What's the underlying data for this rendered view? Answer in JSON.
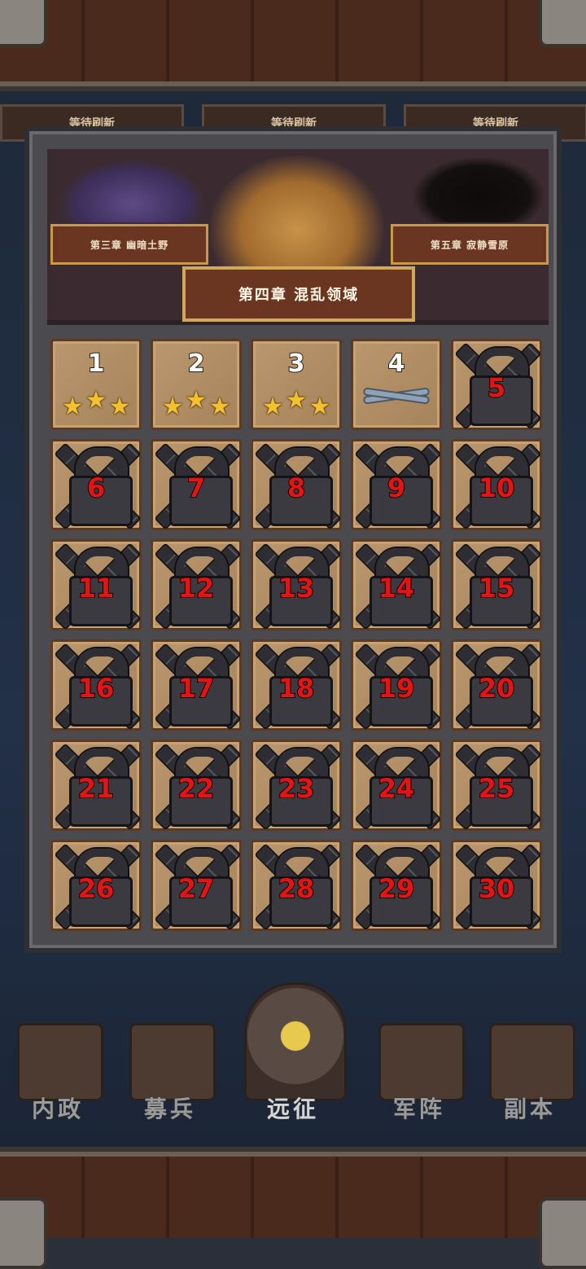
{
  "refresh_tabs": [
    "等待刷新",
    "等待刷新",
    "等待刷新"
  ],
  "chapters": {
    "prev": "第三章  幽暗土野",
    "current": "第四章  混乱领域",
    "next": "第五章  寂静雪原"
  },
  "levels": [
    {
      "number": "1",
      "state": "cleared",
      "stars": 3
    },
    {
      "number": "2",
      "state": "cleared",
      "stars": 3
    },
    {
      "number": "3",
      "state": "cleared",
      "stars": 3
    },
    {
      "number": "4",
      "state": "current",
      "stars": 0
    },
    {
      "number": "5",
      "state": "locked"
    },
    {
      "number": "6",
      "state": "locked"
    },
    {
      "number": "7",
      "state": "locked"
    },
    {
      "number": "8",
      "state": "locked"
    },
    {
      "number": "9",
      "state": "locked"
    },
    {
      "number": "10",
      "state": "locked"
    },
    {
      "number": "11",
      "state": "locked"
    },
    {
      "number": "12",
      "state": "locked"
    },
    {
      "number": "13",
      "state": "locked"
    },
    {
      "number": "14",
      "state": "locked"
    },
    {
      "number": "15",
      "state": "locked"
    },
    {
      "number": "16",
      "state": "locked"
    },
    {
      "number": "17",
      "state": "locked"
    },
    {
      "number": "18",
      "state": "locked"
    },
    {
      "number": "19",
      "state": "locked"
    },
    {
      "number": "20",
      "state": "locked"
    },
    {
      "number": "21",
      "state": "locked"
    },
    {
      "number": "22",
      "state": "locked"
    },
    {
      "number": "23",
      "state": "locked"
    },
    {
      "number": "24",
      "state": "locked"
    },
    {
      "number": "25",
      "state": "locked"
    },
    {
      "number": "26",
      "state": "locked"
    },
    {
      "number": "27",
      "state": "locked"
    },
    {
      "number": "28",
      "state": "locked"
    },
    {
      "number": "29",
      "state": "locked"
    },
    {
      "number": "30",
      "state": "locked"
    }
  ],
  "nav": [
    {
      "label": "内政",
      "icon": "scroll-icon"
    },
    {
      "label": "募兵",
      "icon": "helmets-icon"
    },
    {
      "label": "远征",
      "icon": "sword-emblem-icon",
      "active": true
    },
    {
      "label": "军阵",
      "icon": "chess-knight-icon"
    },
    {
      "label": "副本",
      "icon": "flame-tower-icon"
    }
  ],
  "colors": {
    "star": "#f3c12e",
    "locked_number": "#e51414",
    "chapter_banner": "#6a3622",
    "chapter_border": "#d1a85a"
  }
}
